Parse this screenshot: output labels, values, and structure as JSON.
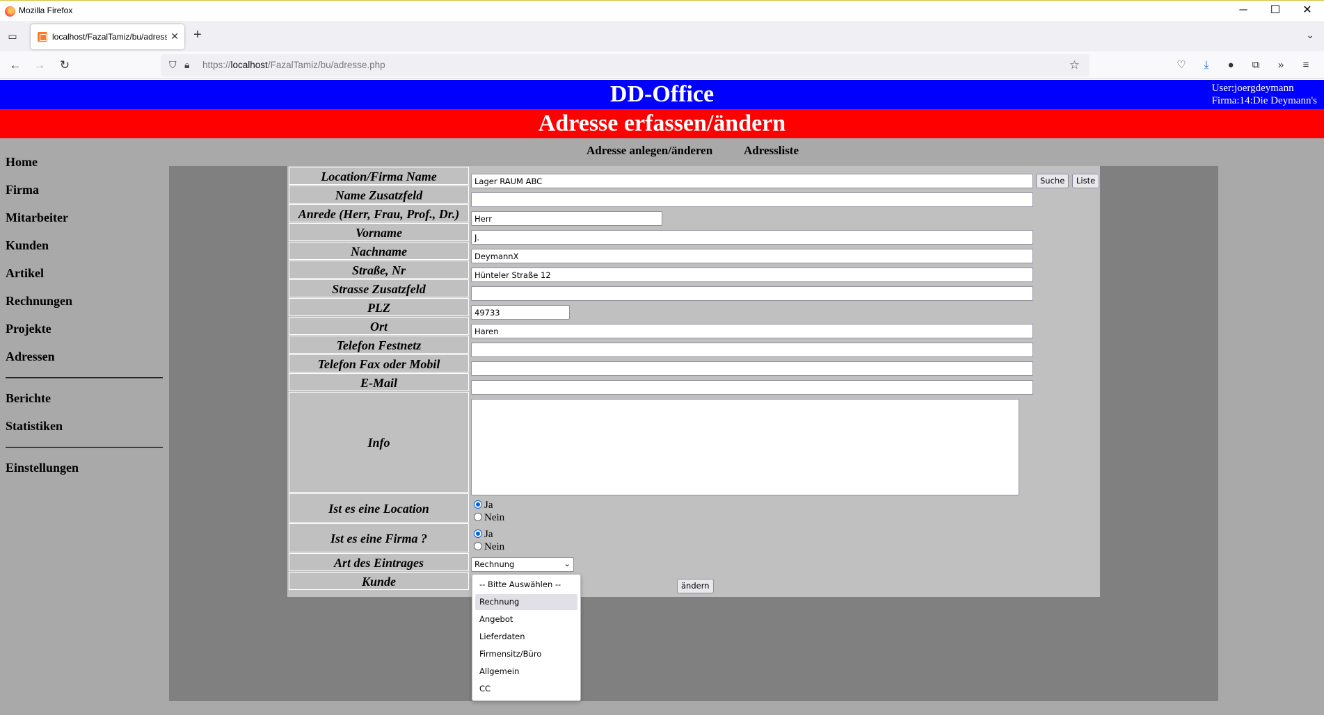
{
  "window": {
    "title": "Mozilla Firefox",
    "min": "─",
    "max": "☐",
    "close": "✕"
  },
  "tab": {
    "title": "localhost/FazalTamiz/bu/adresse.php",
    "close": "✕",
    "new": "+"
  },
  "url": {
    "prefix": "https://",
    "host": "localhost",
    "path": "/FazalTamiz/bu/adresse.php"
  },
  "header": {
    "app_title": "DD-Office",
    "user": "User:joergdeymann",
    "company": "Firma:14:Die Deymann's",
    "page_title": "Adresse erfassen/ändern"
  },
  "sidebar": {
    "items": [
      "Home",
      "Firma",
      "Mitarbeiter",
      "Kunden",
      "Artikel",
      "Rechnungen",
      "Projekte",
      "Adressen"
    ],
    "items2": [
      "Berichte",
      "Statistiken"
    ],
    "items3": [
      "Einstellungen"
    ]
  },
  "subnav": {
    "create": "Adresse anlegen/änderen",
    "list": "Adressliste"
  },
  "form": {
    "labels": {
      "name": "Location/Firma Name",
      "name_extra": "Name Zusatzfeld",
      "salutation": "Anrede (Herr, Frau, Prof., Dr.)",
      "firstname": "Vorname",
      "lastname": "Nachname",
      "street": "Straße, Nr",
      "street_extra": "Strasse Zusatzfeld",
      "zip": "PLZ",
      "city": "Ort",
      "phone": "Telefon Festnetz",
      "fax": "Telefon Fax oder Mobil",
      "email": "E-Mail",
      "info": "Info",
      "is_location": "Ist es eine Location",
      "is_company": "Ist es eine Firma ?",
      "entry_type": "Art des Eintrages",
      "customer": "Kunde"
    },
    "values": {
      "name": "Lager RAUM ABC",
      "name_extra": "",
      "salutation": "Herr",
      "firstname": "J.",
      "lastname": "DeymannX",
      "street": "Hünteler Straße 12",
      "street_extra": "",
      "zip": "49733",
      "city": "Haren",
      "phone": "",
      "fax": "",
      "email": "",
      "info": "",
      "is_location": "Ja",
      "is_company": "Ja",
      "entry_type": "Rechnung"
    },
    "radio": {
      "yes": "Ja",
      "no": "Nein"
    },
    "buttons": {
      "search": "Suche",
      "list": "Liste",
      "submit": "ändern"
    },
    "entry_type_options": [
      "-- Bitte Auswählen --",
      "Rechnung",
      "Angebot",
      "Lieferdaten",
      "Firmensitz/Büro",
      "Allgemein",
      "CC"
    ]
  },
  "colors": {
    "header_blue": "#0000ff",
    "header_red": "#ff0000",
    "page_bg": "#a9a9a9",
    "form_bg": "#808080",
    "panel_bg": "#c0c0c0"
  }
}
